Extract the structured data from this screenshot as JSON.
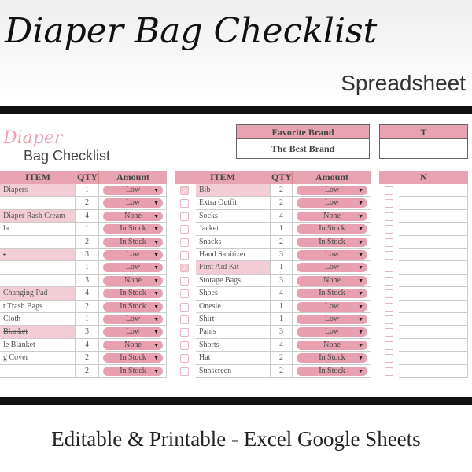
{
  "banner": {
    "title": "Diaper Bag Checklist",
    "subtitle": "Spreadsheet",
    "tagline": "Editable & Printable - Excel Google Sheets"
  },
  "sheet": {
    "title_script": "Diaper",
    "title_text": "Bag Checklist",
    "favorite_brand": {
      "label": "Favorite Brand",
      "value": "The Best Brand"
    },
    "second_box_label": "T",
    "headers": {
      "item": "ITEM",
      "qty": "QTY",
      "amount": "Amount",
      "right": "N"
    },
    "colors": {
      "header": "#e8a3b3",
      "pill": "#e8a0b0",
      "checked_row": "#f2cdd5"
    },
    "left_table": [
      {
        "item": "Diapers",
        "qty": "1",
        "amount": "Low",
        "done": true
      },
      {
        "item": "",
        "qty": "2",
        "amount": "Low",
        "done": false
      },
      {
        "item": "Diaper Rash Cream",
        "qty": "4",
        "amount": "None",
        "done": true
      },
      {
        "item": "la",
        "qty": "1",
        "amount": "In Stock",
        "done": false
      },
      {
        "item": "",
        "qty": "2",
        "amount": "In Stock",
        "done": false
      },
      {
        "item": "r",
        "qty": "3",
        "amount": "Low",
        "done": true
      },
      {
        "item": "",
        "qty": "1",
        "amount": "Low",
        "done": false
      },
      {
        "item": "",
        "qty": "3",
        "amount": "None",
        "done": false
      },
      {
        "item": "Changing Pad",
        "qty": "4",
        "amount": "In Stock",
        "done": true
      },
      {
        "item": "t Trash Bags",
        "qty": "2",
        "amount": "In Stock",
        "done": false
      },
      {
        "item": "Cloth",
        "qty": "1",
        "amount": "Low",
        "done": false
      },
      {
        "item": "Blanket",
        "qty": "3",
        "amount": "Low",
        "done": true
      },
      {
        "item": "le Blanket",
        "qty": "4",
        "amount": "None",
        "done": false
      },
      {
        "item": "g Cover",
        "qty": "2",
        "amount": "In Stock",
        "done": false
      },
      {
        "item": "",
        "qty": "2",
        "amount": "In Stock",
        "done": false
      }
    ],
    "middle_table": [
      {
        "item": "Bib",
        "qty": "2",
        "amount": "Low",
        "done": true
      },
      {
        "item": "Extra Outfit",
        "qty": "2",
        "amount": "Low",
        "done": false
      },
      {
        "item": "Socks",
        "qty": "4",
        "amount": "None",
        "done": false
      },
      {
        "item": "Jacket",
        "qty": "1",
        "amount": "In Stock",
        "done": false
      },
      {
        "item": "Snacks",
        "qty": "2",
        "amount": "In Stock",
        "done": false
      },
      {
        "item": "Hand Sanitizer",
        "qty": "3",
        "amount": "Low",
        "done": false
      },
      {
        "item": "First Aid Kit",
        "qty": "1",
        "amount": "Low",
        "done": true
      },
      {
        "item": "Storage Bags",
        "qty": "3",
        "amount": "None",
        "done": false
      },
      {
        "item": "Shoes",
        "qty": "4",
        "amount": "In Stock",
        "done": false
      },
      {
        "item": "Onesie",
        "qty": "1",
        "amount": "Low",
        "done": false
      },
      {
        "item": "Shirt",
        "qty": "1",
        "amount": "Low",
        "done": false
      },
      {
        "item": "Pants",
        "qty": "3",
        "amount": "Low",
        "done": false
      },
      {
        "item": "Shorts",
        "qty": "4",
        "amount": "None",
        "done": false
      },
      {
        "item": "Hat",
        "qty": "2",
        "amount": "In Stock",
        "done": false
      },
      {
        "item": "Sunscreen",
        "qty": "2",
        "amount": "In Stock",
        "done": false
      }
    ],
    "right_rows": 15
  }
}
